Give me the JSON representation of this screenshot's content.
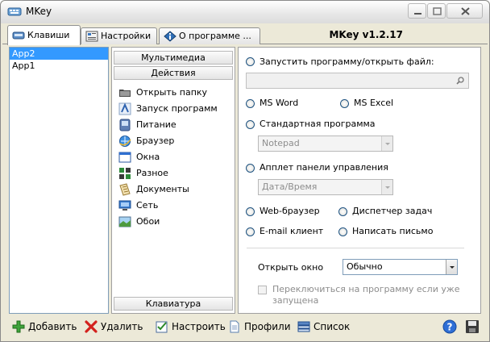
{
  "window": {
    "title": "MKey"
  },
  "tabs": [
    {
      "label": "Клавиши",
      "icon": "keyboard-icon"
    },
    {
      "label": "Настройки",
      "icon": "settings-icon"
    },
    {
      "label": "О программе ...",
      "icon": "info-icon"
    }
  ],
  "version": "MKey v1.2.17",
  "apps": [
    {
      "label": "App2",
      "selected": true
    },
    {
      "label": "App1",
      "selected": false
    }
  ],
  "sections": {
    "multimedia": "Мультимедиа",
    "actions": "Действия",
    "keyboard": "Клавиатура"
  },
  "actions": [
    {
      "label": "Открыть папку",
      "icon": "folder-icon"
    },
    {
      "label": "Запуск программ",
      "icon": "run-programs-icon"
    },
    {
      "label": "Питание",
      "icon": "power-icon"
    },
    {
      "label": "Браузер",
      "icon": "browser-icon"
    },
    {
      "label": "Окна",
      "icon": "windows-icon"
    },
    {
      "label": "Разное",
      "icon": "misc-icon"
    },
    {
      "label": "Документы",
      "icon": "documents-icon"
    },
    {
      "label": "Сеть",
      "icon": "network-icon"
    },
    {
      "label": "Обои",
      "icon": "wallpaper-icon"
    }
  ],
  "options": {
    "run_program": "Запустить программу/открыть файл:",
    "run_program_value": "",
    "ms_word": "MS Word",
    "ms_excel": "MS Excel",
    "standard_program": "Стандартная программа",
    "standard_program_value": "Notepad",
    "control_panel": "Апплет панели управления",
    "control_panel_value": "Дата/Время",
    "web_browser": "Web-браузер",
    "task_manager": "Диспетчер задач",
    "email_client": "E-mail клиент",
    "write_letter": "Написать письмо"
  },
  "open_window": {
    "label": "Открыть окно",
    "value": "Обычно"
  },
  "switch_checkbox": {
    "label_line1": "Переключиться на программу если уже",
    "label_line2": "запущена"
  },
  "toolbar": {
    "add": "Добавить",
    "delete": "Удалить",
    "configure": "Настроить",
    "profiles": "Профили",
    "list": "Список"
  },
  "colors": {
    "selection": "#3399ff",
    "window_bg": "#ece9d8",
    "border": "#7f9db9"
  }
}
